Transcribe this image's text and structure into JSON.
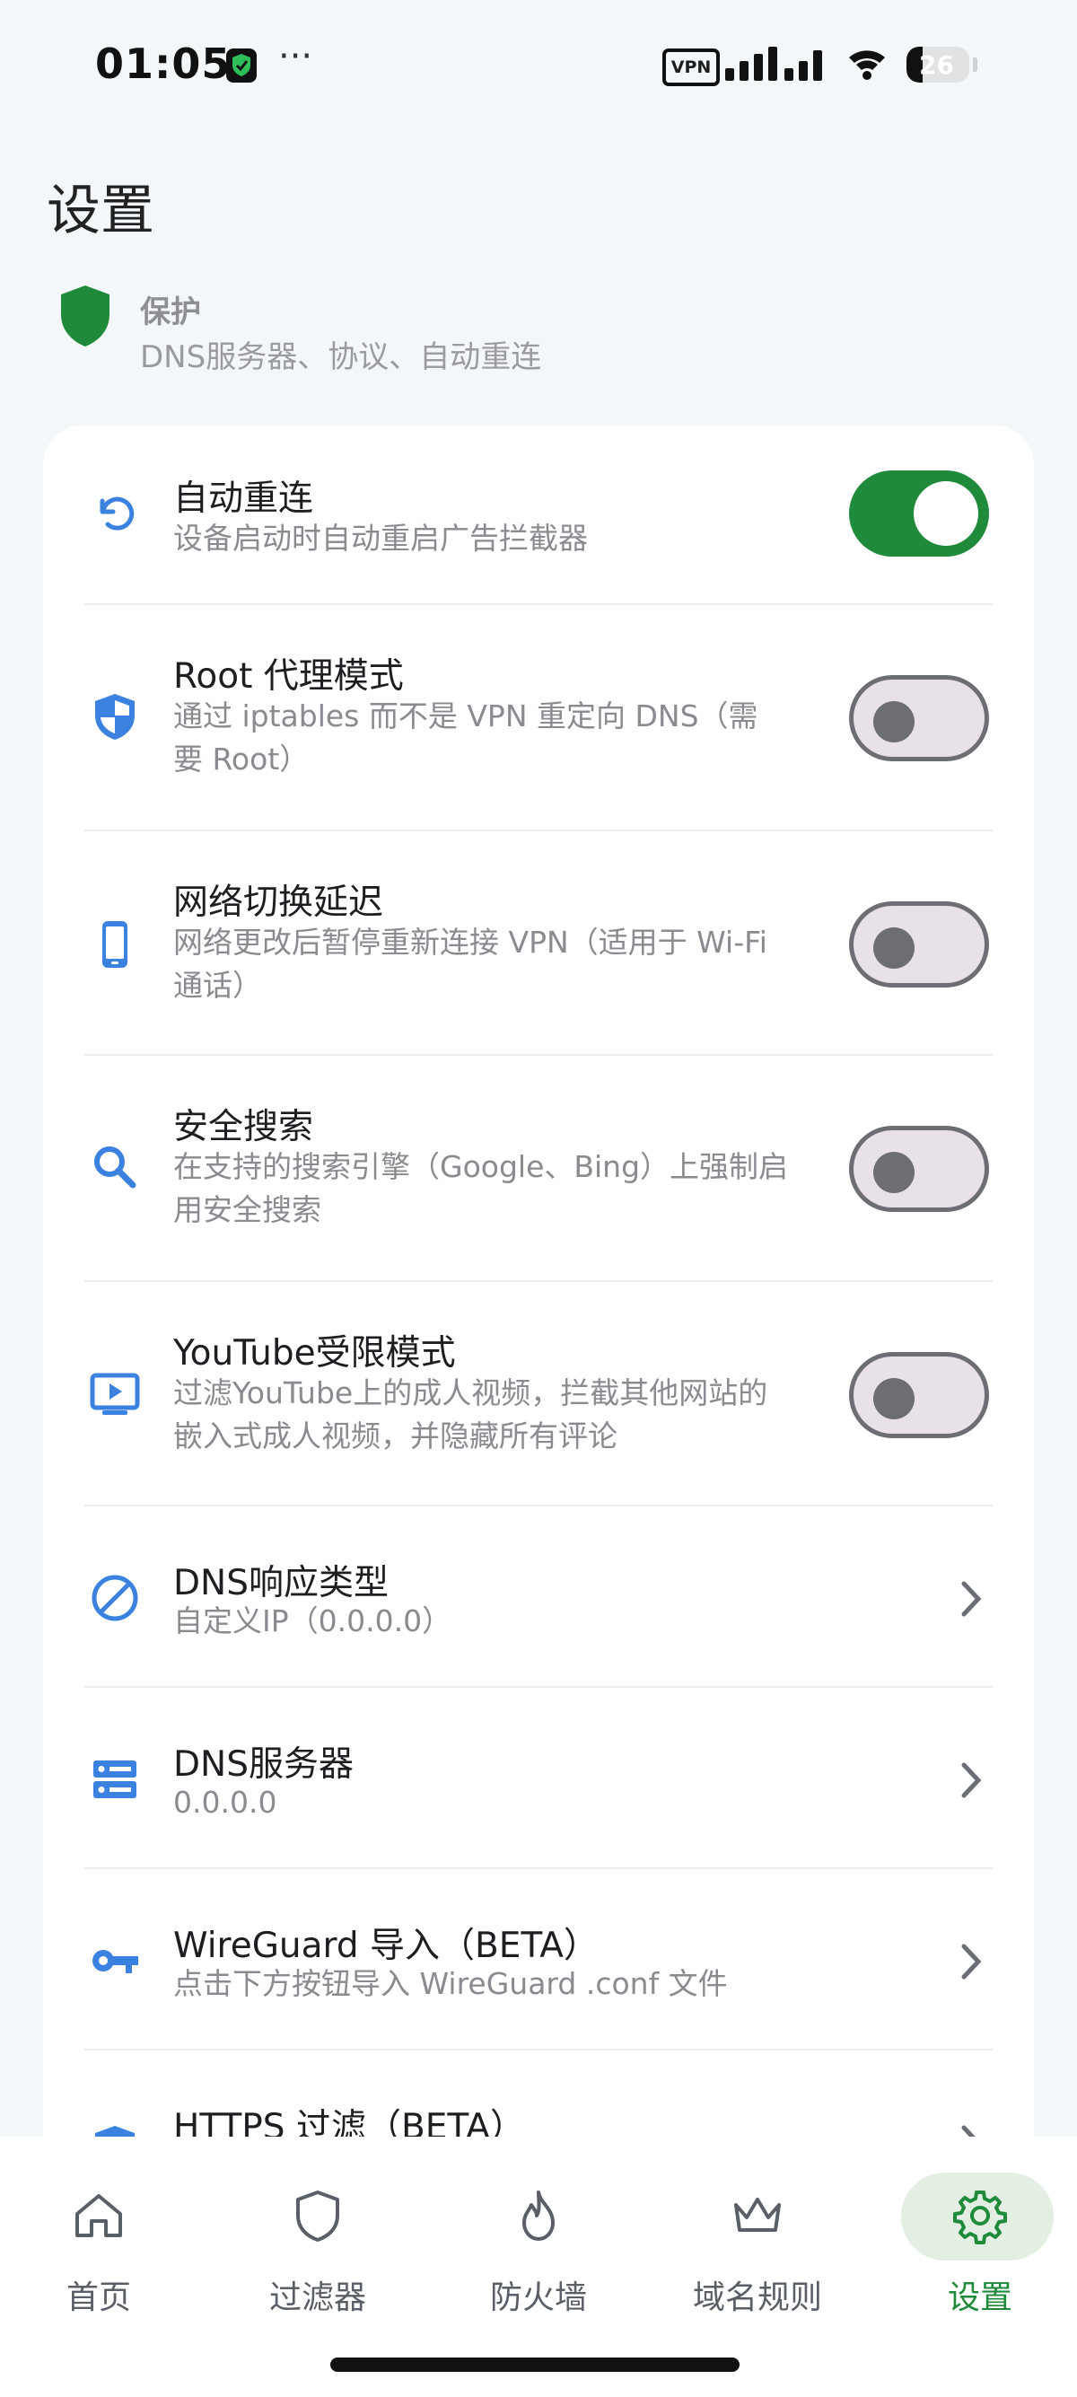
{
  "status_bar": {
    "time": "01:05",
    "vpn_label": "VPN",
    "battery": "26",
    "icons": [
      "shield-check-icon",
      "more-dots-icon",
      "vpn-icon",
      "signal-icon",
      "wifi-icon",
      "battery-icon"
    ]
  },
  "page": {
    "title": "设置"
  },
  "section": {
    "title": "保护",
    "subtitle": "DNS服务器、协议、自动重连",
    "icon": "shield-icon",
    "accent": "#1f8a3a"
  },
  "settings": [
    {
      "title": "自动重连",
      "sub1": "设备启动时自动重启广告拦截器",
      "sub2": "",
      "control": "toggle",
      "on": true,
      "icon": "refresh-icon"
    },
    {
      "title": "Root 代理模式",
      "sub1": "通过 iptables 而不是 VPN 重定向 DNS（需",
      "sub2": "要 Root）",
      "control": "toggle",
      "on": false,
      "icon": "shield-half-icon"
    },
    {
      "title": "网络切换延迟",
      "sub1": "网络更改后暂停重新连接 VPN（适用于 Wi-Fi",
      "sub2": "通话）",
      "control": "toggle",
      "on": false,
      "icon": "phone-icon"
    },
    {
      "title": "安全搜索",
      "sub1": "在支持的搜索引擎（Google、Bing）上强制启",
      "sub2": "用安全搜索",
      "control": "toggle",
      "on": false,
      "icon": "search-icon"
    },
    {
      "title": "YouTube受限模式",
      "sub1": "过滤YouTube上的成人视频，拦截其他网站的",
      "sub2": "嵌入式成人视频，并隐藏所有评论",
      "control": "toggle",
      "on": false,
      "icon": "tv-play-icon"
    },
    {
      "title": "DNS响应类型",
      "sub1": "自定义IP（0.0.0.0）",
      "sub2": "",
      "control": "chevron",
      "icon": "block-icon"
    },
    {
      "title": "DNS服务器",
      "sub1": "0.0.0.0",
      "sub2": "",
      "control": "chevron",
      "icon": "server-icon"
    },
    {
      "title": "WireGuard 导入（BETA）",
      "sub1": "点击下方按钮导入 WireGuard .conf 文件",
      "sub2": "",
      "control": "chevron",
      "icon": "key-icon"
    },
    {
      "title": "HTTPS 过滤（BETA）",
      "sub1": "",
      "sub2": "",
      "control": "chevron",
      "icon": "lock-icon"
    }
  ],
  "nav": {
    "items": [
      {
        "label": "首页",
        "icon": "home-icon",
        "active": false
      },
      {
        "label": "过滤器",
        "icon": "shield-outline-icon",
        "active": false
      },
      {
        "label": "防火墙",
        "icon": "flame-icon",
        "active": false
      },
      {
        "label": "域名规则",
        "icon": "crown-icon",
        "active": false
      },
      {
        "label": "设置",
        "icon": "gear-icon",
        "active": true
      }
    ]
  },
  "colors": {
    "primary_green": "#1f8a3a",
    "icon_blue": "#3b82e0",
    "background": "#f4f7fa"
  }
}
